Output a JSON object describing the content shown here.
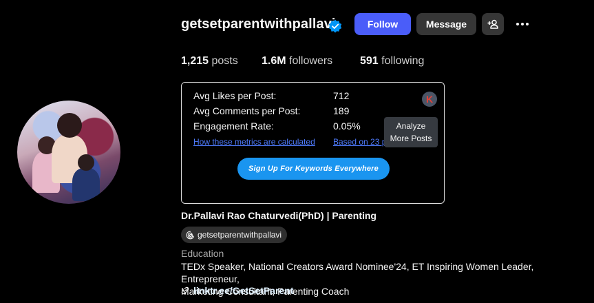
{
  "profile": {
    "username": "getsetparentwithpallavi",
    "follow_label": "Follow",
    "message_label": "Message",
    "stats": {
      "posts_count": "1,215",
      "posts_label": "posts",
      "followers_count": "1.6M",
      "followers_label": "followers",
      "following_count": "591",
      "following_label": "following"
    },
    "full_name": "Dr.Pallavi Rao Chaturvedi(PhD) | Parenting",
    "threads_handle": "getsetparentwithpallavi",
    "category": "Education",
    "bio_line1": "TEDx Speaker, National Creators Award Nominee'24, ET Inspiring Women Leader, Entrepreneur,",
    "bio_line2": "Marketing Consultant, Parenting Coach",
    "link": "linktr.ee/GetSetParent"
  },
  "metrics_widget": {
    "rows": [
      {
        "label": "Avg Likes per Post:",
        "value": "712"
      },
      {
        "label": "Avg Comments per Post:",
        "value": "189"
      },
      {
        "label": "Engagement Rate:",
        "value": "0.05%"
      }
    ],
    "link_left": "How these metrics are calculated",
    "link_right": "Based on 23 p",
    "badge_letter": "K",
    "tooltip_line1": "Analyze",
    "tooltip_line2": "More Posts",
    "signup_label": "Sign Up For Keywords Everywhere"
  },
  "colors": {
    "background": "#000000",
    "follow_button": "#4a5df9",
    "secondary_button": "#363636",
    "signup_button": "#1a95f0",
    "link_blue": "#4f7cff",
    "verified_badge": "#0095f6"
  },
  "icons": [
    "verified-badge-icon",
    "add-person-icon",
    "more-options-icon",
    "threads-icon",
    "link-icon",
    "keywords-everywhere-icon"
  ]
}
